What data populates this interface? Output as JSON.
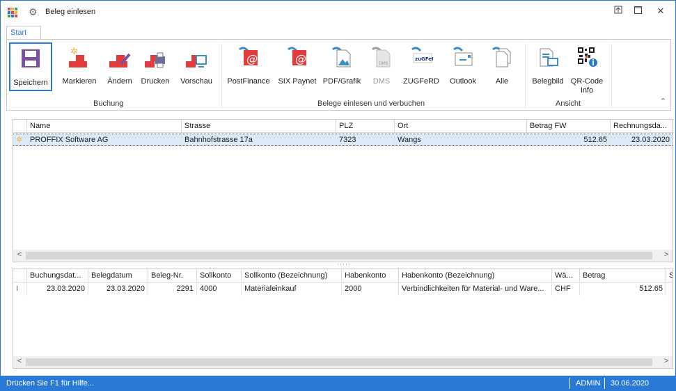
{
  "window": {
    "title": "Beleg einlesen"
  },
  "ribbon": {
    "tab": "Start",
    "groups": [
      {
        "label": "Buchung"
      },
      {
        "label": "Belege einlesen und verbuchen"
      },
      {
        "label": "Ansicht"
      }
    ],
    "buttons": [
      {
        "label": "Speichern"
      },
      {
        "label": "Markieren"
      },
      {
        "label": "Ändern"
      },
      {
        "label": "Drucken"
      },
      {
        "label": "Vorschau"
      },
      {
        "label": "PostFinance"
      },
      {
        "label": "SIX Paynet"
      },
      {
        "label": "PDF/Grafik"
      },
      {
        "label": "DMS"
      },
      {
        "label": "ZUGFeRD"
      },
      {
        "label": "Outlook"
      },
      {
        "label": "Alle"
      },
      {
        "label": "Belegbild"
      },
      {
        "label": "QR-Code\nInfo"
      }
    ],
    "icon_text": {
      "dms": "DMS",
      "zugferd": "zuGFeRD"
    }
  },
  "grid1": {
    "columns": [
      "Name",
      "Strasse",
      "PLZ",
      "Ort",
      "Betrag FW",
      "Rechnungsda..."
    ],
    "rows": [
      [
        "PROFFIX Software AG",
        "Bahnhofstrasse 17a",
        "7323",
        "Wangs",
        "512.65",
        "23.03.2020"
      ]
    ]
  },
  "grid2": {
    "columns": [
      "Buchungsdat...",
      "Belegdatum",
      "Beleg-Nr.",
      "Sollkonto",
      "Sollkonto (Bezeichnung)",
      "Habenkonto",
      "Habenkonto (Bezeichnung)",
      "Wä...",
      "Betrag",
      "S"
    ],
    "rows": [
      [
        "23.03.2020",
        "23.03.2020",
        "2291",
        "4000",
        "Materialeinkauf",
        "2000",
        "Verbindlichkeiten für Material- und Ware...",
        "CHF",
        "512.65",
        ""
      ]
    ]
  },
  "status": {
    "help": "Drücken Sie F1 für Hilfe...",
    "user": "ADMIN",
    "date": "30.06.2020"
  },
  "colors": {
    "accent": "#2b79d6",
    "red": "#e23b3b",
    "orange": "#f5b03a",
    "teal": "#3b8fc9"
  }
}
